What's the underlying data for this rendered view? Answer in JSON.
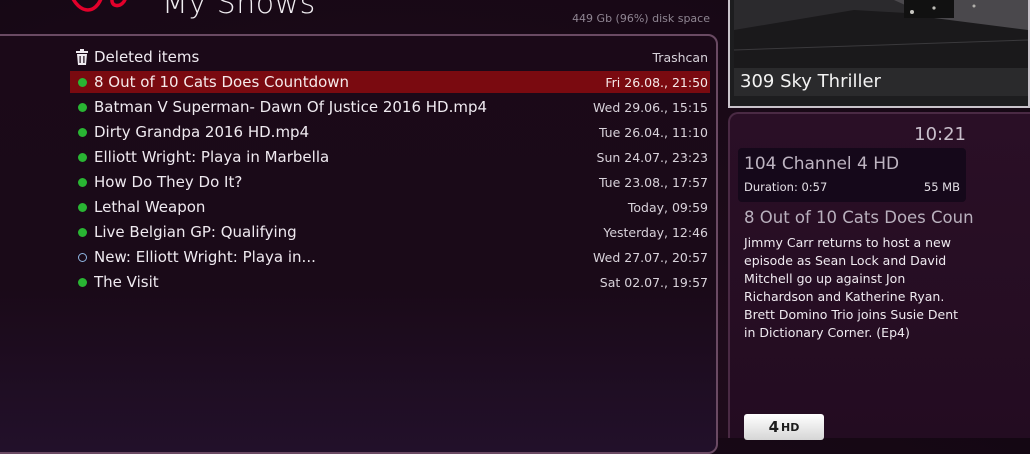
{
  "header": {
    "title": "My Shows",
    "disk_space": "449 Gb (96%) disk space"
  },
  "recordings": [
    {
      "marker": "trash-icon",
      "name": "Deleted items",
      "date": "Trashcan"
    },
    {
      "marker": "watched-dot",
      "name": "8 Out of 10 Cats Does Countdown",
      "date": "Fri 26.08., 21:50",
      "selected": true
    },
    {
      "marker": "watched-dot",
      "name": "Batman V Superman- Dawn Of Justice 2016 HD.mp4",
      "date": "Wed 29.06., 15:15"
    },
    {
      "marker": "watched-dot",
      "name": "Dirty Grandpa 2016 HD.mp4",
      "date": "Tue 26.04., 11:10"
    },
    {
      "marker": "watched-dot",
      "name": "Elliott Wright: Playa in Marbella",
      "date": "Sun 24.07., 23:23"
    },
    {
      "marker": "watched-dot",
      "name": "How Do They Do It?",
      "date": "Tue 23.08., 17:57"
    },
    {
      "marker": "watched-dot",
      "name": "Lethal Weapon",
      "date": "Today, 09:59"
    },
    {
      "marker": "watched-dot",
      "name": "Live Belgian GP: Qualifying",
      "date": "Yesterday, 12:46"
    },
    {
      "marker": "new-ring",
      "name": "New: Elliott Wright: Playa in...",
      "date": "Wed 27.07., 20:57"
    },
    {
      "marker": "watched-dot",
      "name": "The Visit",
      "date": "Sat 02.07., 19:57"
    }
  ],
  "preview": {
    "channel_label": "309 Sky Thriller"
  },
  "info": {
    "clock": "10:21",
    "channel": "104 Channel 4 HD",
    "duration": "Duration: 0:57",
    "size": "55 MB",
    "title": "8 Out of 10 Cats Does Coun",
    "description": "Jimmy Carr returns to host a new episode as Sean Lock and David Mitchell go up against Jon Richardson and Katherine Ryan. Brett Domino Trio joins Susie Dent in Dictionary Corner. (Ep4)",
    "hd_badge": "HD"
  },
  "colors": {
    "selected_row": "#7a0a10",
    "watched_dot": "#29b533",
    "new_ring": "#8fb6e2",
    "logo_red": "#e3002b"
  }
}
